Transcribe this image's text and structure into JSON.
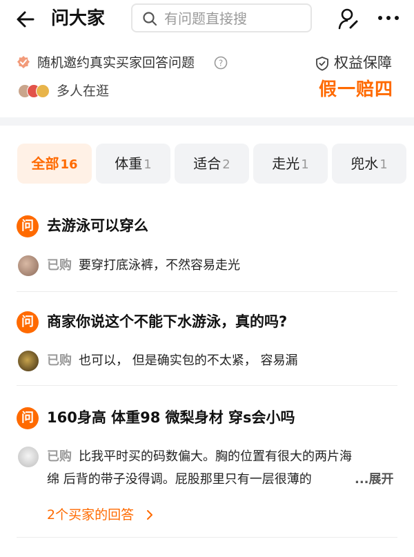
{
  "header": {
    "title": "问大家",
    "search_placeholder": "有问题直接搜"
  },
  "service": {
    "invite_text": "随机邀约真实买家回答问题",
    "guarantee_label": "权益保障",
    "browsing_text": "多人在逛",
    "promise_text": "假一赔四"
  },
  "tabs": [
    {
      "label": "全部",
      "count": "16",
      "active": true
    },
    {
      "label": "体重",
      "count": "1"
    },
    {
      "label": "适合",
      "count": "2"
    },
    {
      "label": "走光",
      "count": "1"
    },
    {
      "label": "兜水",
      "count": "1"
    }
  ],
  "questions": [
    {
      "q_badge": "问",
      "title": "去游泳可以穿么",
      "bought_label": "已购",
      "answer": "要穿打底泳裤，不然容易走光"
    },
    {
      "q_badge": "问",
      "title": "商家你说这个不能下水游泳，真的吗?",
      "bought_label": "已购",
      "answer": "也可以， 但是确实包的不太紧， 容易漏"
    },
    {
      "q_badge": "问",
      "title": "160身高 体重98 微梨身材 穿s会小吗",
      "bought_label": "已购",
      "answer_line1": "比我平时买的码数偏大。胸的位置有很大的两片海",
      "answer_line2": "绵 后背的带子没得调。屁股那里只有一层很薄的",
      "expand_label": "...展开",
      "more_answers": "2个买家的回答"
    }
  ],
  "colors": {
    "accent": "#ff6a00",
    "bought_gray": "#9a9a9a",
    "tab_bg": "#f2f3f5",
    "tab_active_bg": "#fff1e6"
  }
}
